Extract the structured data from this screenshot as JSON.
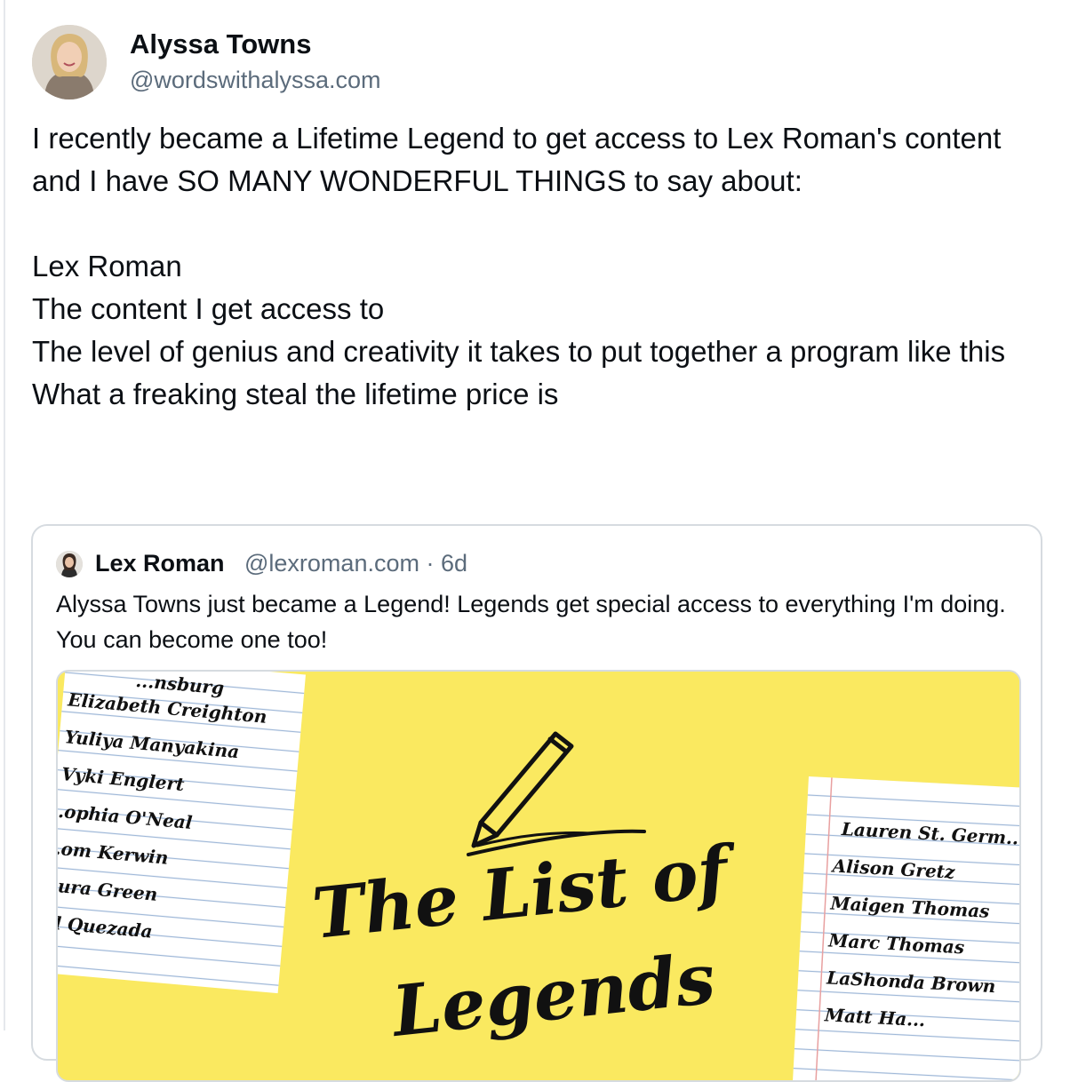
{
  "post": {
    "author_name": "Alyssa Towns",
    "author_handle": "@wordswithalyssa.com",
    "text": "I recently became a Lifetime Legend to get access to Lex Roman's content and I have SO MANY WONDERFUL THINGS to say about:\n\nLex Roman\nThe content I get access to\nThe level of genius and creativity it takes to put together a program like this\nWhat a freaking steal the lifetime price is"
  },
  "quote": {
    "author_name": "Lex Roman",
    "author_handle": "@lexroman.com",
    "separator": "·",
    "time": "6d",
    "text": "Alyssa Towns just became a Legend! Legends get special access to everything I'm doing. You can become one too!"
  },
  "image": {
    "title_line1": "The List of",
    "title_line2": "Legends",
    "left_note_top_fragment": "...nsburg",
    "left_names": [
      "Elizabeth Creighton",
      "Yuliya Manyakina",
      "Vyki Englert",
      "...ophia O'Neal",
      "...om Kerwin",
      "...ura Green",
      "...l Quezada"
    ],
    "right_names": [
      "Lauren St. Germ...",
      "Alison Gretz",
      "Maigen Thomas",
      "Marc Thomas",
      "LaShonda Brown",
      "Matt Ha..."
    ]
  },
  "colors": {
    "text": "#0b0f14",
    "muted": "#5b6b7b",
    "border": "#d6dbe0",
    "image_background": "#fae960"
  }
}
